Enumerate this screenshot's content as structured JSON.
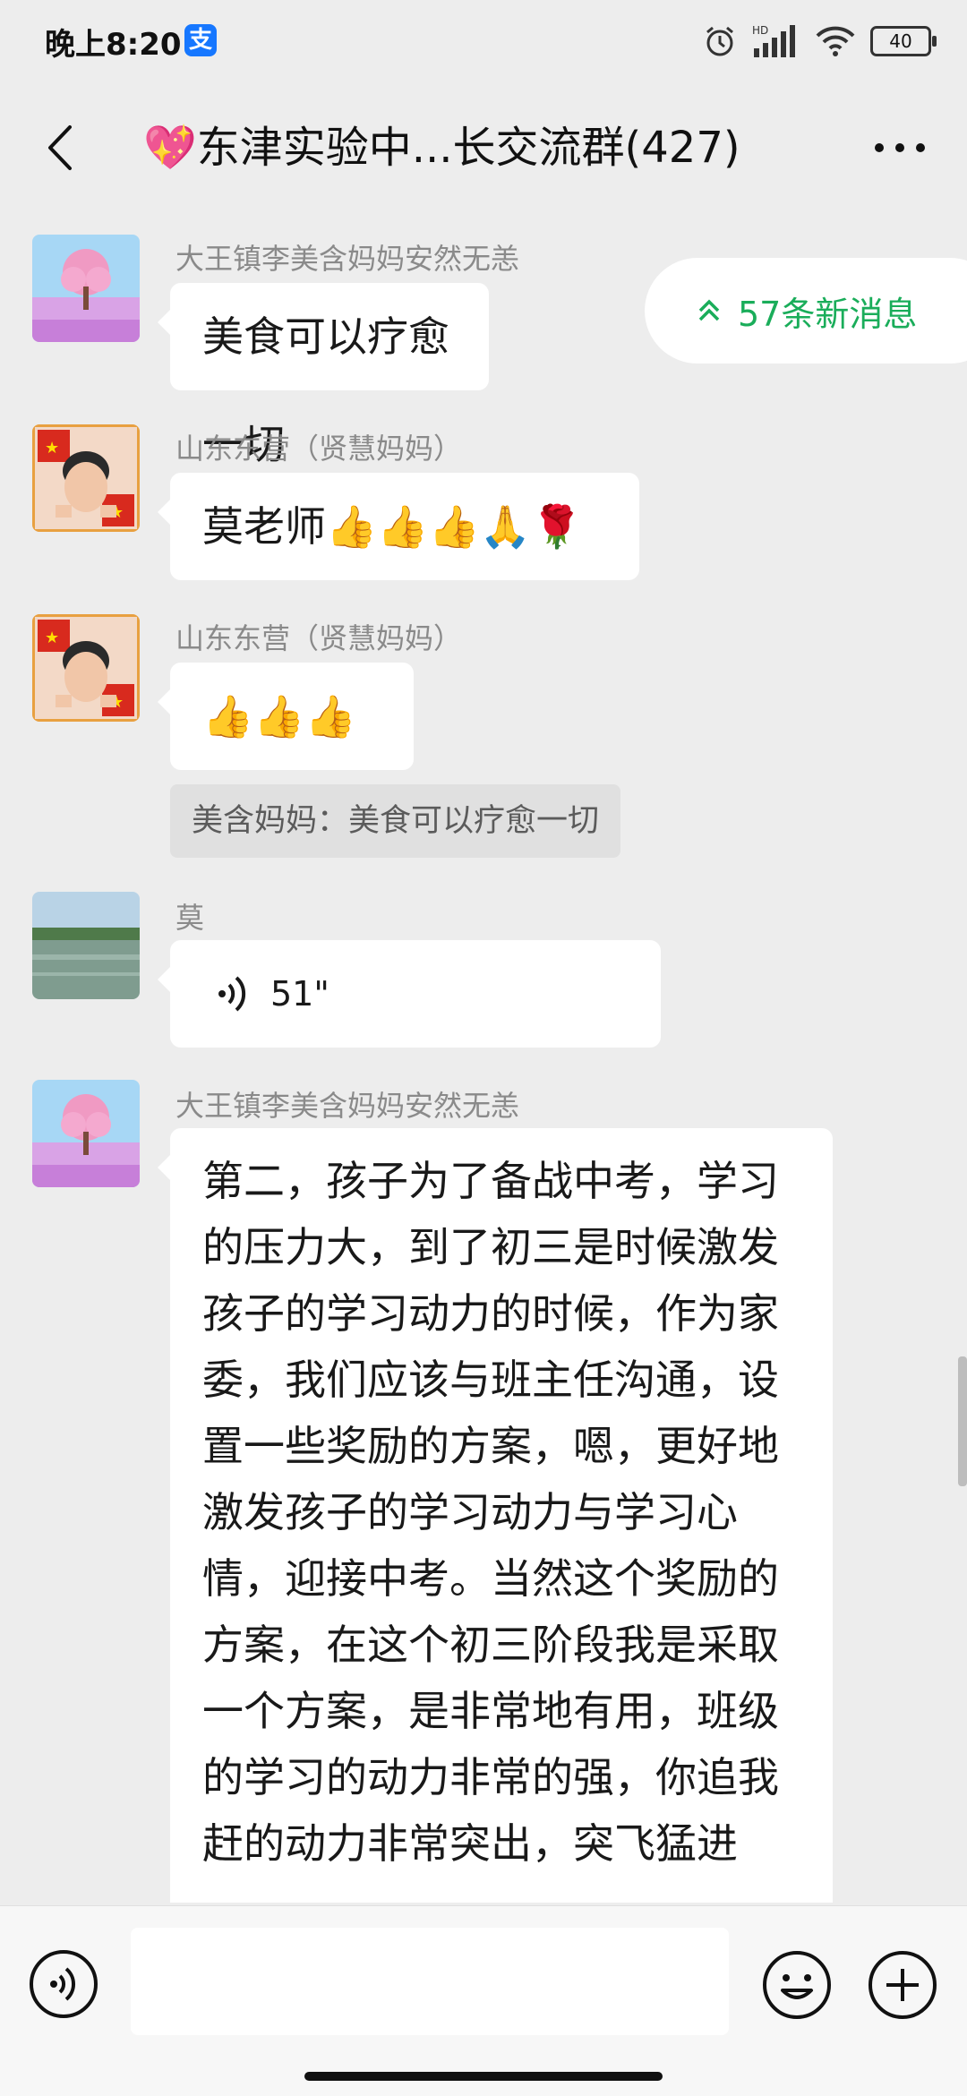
{
  "status_bar": {
    "time": "晚上8:20",
    "app_badge": "支",
    "hd_label": "HD",
    "battery": "40",
    "icons": [
      "alarm-icon",
      "signal-icon",
      "wifi-icon",
      "battery-icon"
    ]
  },
  "header": {
    "title": "💖东津实验中...长交流群(427)",
    "back_icon": "back-arrow-icon",
    "more_icon": "more-dots-icon"
  },
  "new_messages": {
    "label": "57条新消息",
    "icon": "double-chevron-up-icon",
    "color": "#1aad5a"
  },
  "messages": [
    {
      "sender": "大王镇李美含妈妈安然无恙",
      "type": "text",
      "text": "美食可以疗愈一切",
      "avatar": "pink-tree-avatar"
    },
    {
      "sender": "山东东营（贤慧妈妈）",
      "type": "text",
      "text": "莫老师👍👍👍🙏🌹",
      "avatar": "child-flag-avatar"
    },
    {
      "sender": "山东东营（贤慧妈妈）",
      "type": "text",
      "text": "👍👍👍",
      "avatar": "child-flag-avatar",
      "quote": "美含妈妈：美食可以疗愈一切"
    },
    {
      "sender": "莫",
      "type": "voice",
      "duration": "51\"",
      "avatar": "lake-avatar"
    },
    {
      "sender": "大王镇李美含妈妈安然无恙",
      "type": "text",
      "avatar": "pink-tree-avatar",
      "text": "第二，孩子为了备战中考，学习的压力大，到了初三是时候激发孩子的学习动力的时候，作为家委，我们应该与班主任沟通，设置一些奖励的方案，嗯，更好地激发孩子的学习动力与学习心情，迎接中考。当然这个奖励的方案，在这个初三阶段我是采取一个方案，是非常地有用，班级的学习的动力非常的强，你追我赶的动力非常突出，突飞猛进"
    }
  ],
  "input_bar": {
    "placeholder": "",
    "icons": [
      "voice-input-icon",
      "emoji-icon",
      "plus-icon"
    ]
  },
  "colors": {
    "background": "#ededed",
    "bubble": "#ffffff",
    "accent_green": "#1aad5a"
  }
}
